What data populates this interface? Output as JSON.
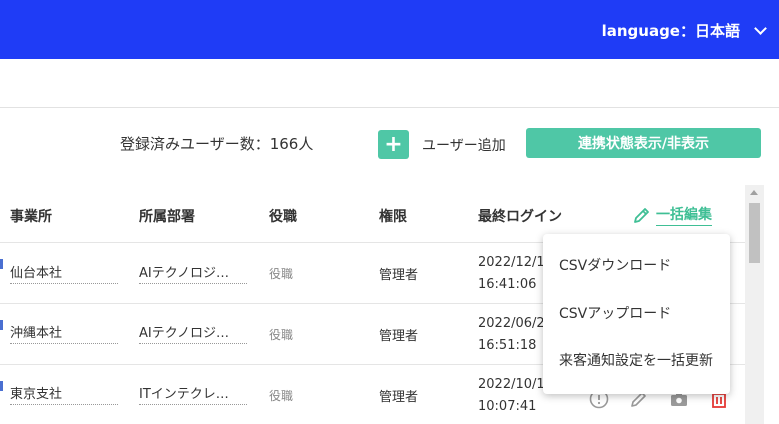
{
  "header": {
    "language_label": "language：日本語"
  },
  "toolbar": {
    "user_count": "登録済みユーザー数：166人",
    "add_icon": "+",
    "add_user_label": "ユーザー追加",
    "toggle_link_label": "連携状態表示/非表示"
  },
  "table": {
    "columns": [
      "事業所",
      "所属部署",
      "役職",
      "権限",
      "最終ログイン"
    ],
    "bulk_edit_label": "一括編集",
    "rows": [
      {
        "office": "仙台本社",
        "dept": "AIテクノロジ…",
        "role": "役職",
        "perm": "管理者",
        "login_date": "2022/12/1",
        "login_time": "16:41:06"
      },
      {
        "office": "沖縄本社",
        "dept": "AIテクノロジ…",
        "role": "役職",
        "perm": "管理者",
        "login_date": "2022/06/2",
        "login_time": "16:51:18"
      },
      {
        "office": "東京支社",
        "dept": "ITインテクレ…",
        "role": "役職",
        "perm": "管理者",
        "login_date": "2022/10/1",
        "login_time": "10:07:41"
      }
    ]
  },
  "menu": {
    "items": [
      "CSVダウンロード",
      "CSVアップロード",
      "来客通知設定を一括更新"
    ]
  },
  "colors": {
    "header_bg": "#1f3cf6",
    "accent_green": "#4fc7a6",
    "delete_red": "#e53935"
  }
}
